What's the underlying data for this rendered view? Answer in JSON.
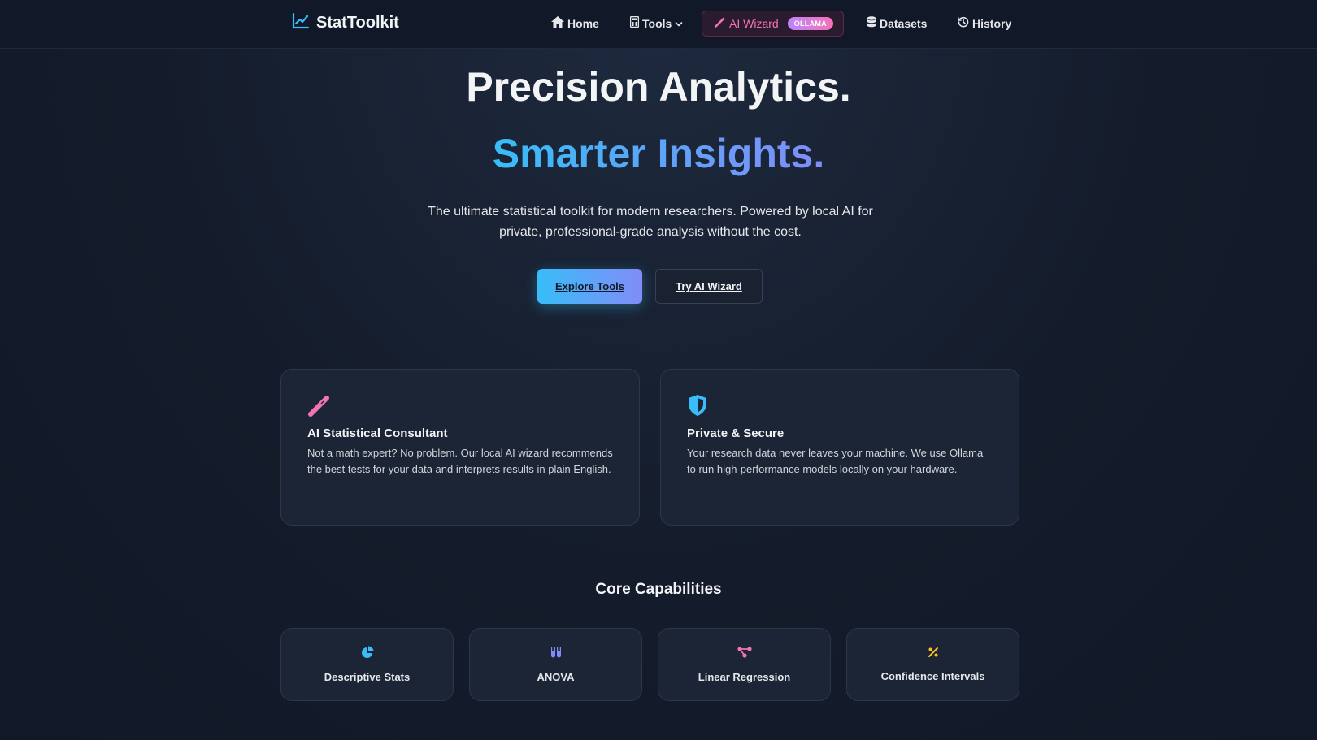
{
  "brand": {
    "name": "StatToolkit",
    "icon": "chart-line-icon"
  },
  "nav": {
    "home": "Home",
    "tools": "Tools",
    "wizard": "AI Wizard",
    "wizard_badge": "OLLAMA",
    "datasets": "Datasets",
    "history": "History"
  },
  "hero": {
    "title": "Precision Analytics.",
    "subtitle": "Smarter Insights.",
    "description": "The ultimate statistical toolkit for modern researchers. Powered by local AI for private, professional-grade analysis without the cost.",
    "primary_cta": "Explore Tools",
    "secondary_cta": "Try AI Wizard"
  },
  "features": [
    {
      "icon": "magic-wand-icon",
      "title": "AI Statistical Consultant",
      "text": "Not a math expert? No problem. Our local AI wizard recommends the best tests for your data and interprets results in plain English."
    },
    {
      "icon": "shield-icon",
      "title": "Private & Secure",
      "text": "Your research data never leaves your machine. We use Ollama to run high-performance models locally on your hardware."
    }
  ],
  "capabilities": {
    "title": "Core Capabilities",
    "items": [
      {
        "icon": "pie-chart-icon",
        "label": "Descriptive Stats"
      },
      {
        "icon": "vials-icon",
        "label": "ANOVA"
      },
      {
        "icon": "nodes-icon",
        "label": "Linear Regression"
      },
      {
        "icon": "percent-icon",
        "label": "Confidence Intervals"
      }
    ]
  },
  "colors": {
    "accent_cyan": "#38bdf8",
    "accent_violet": "#818cf8",
    "accent_pink": "#f472b6",
    "accent_amber": "#fbbf24",
    "background": "#111827"
  }
}
